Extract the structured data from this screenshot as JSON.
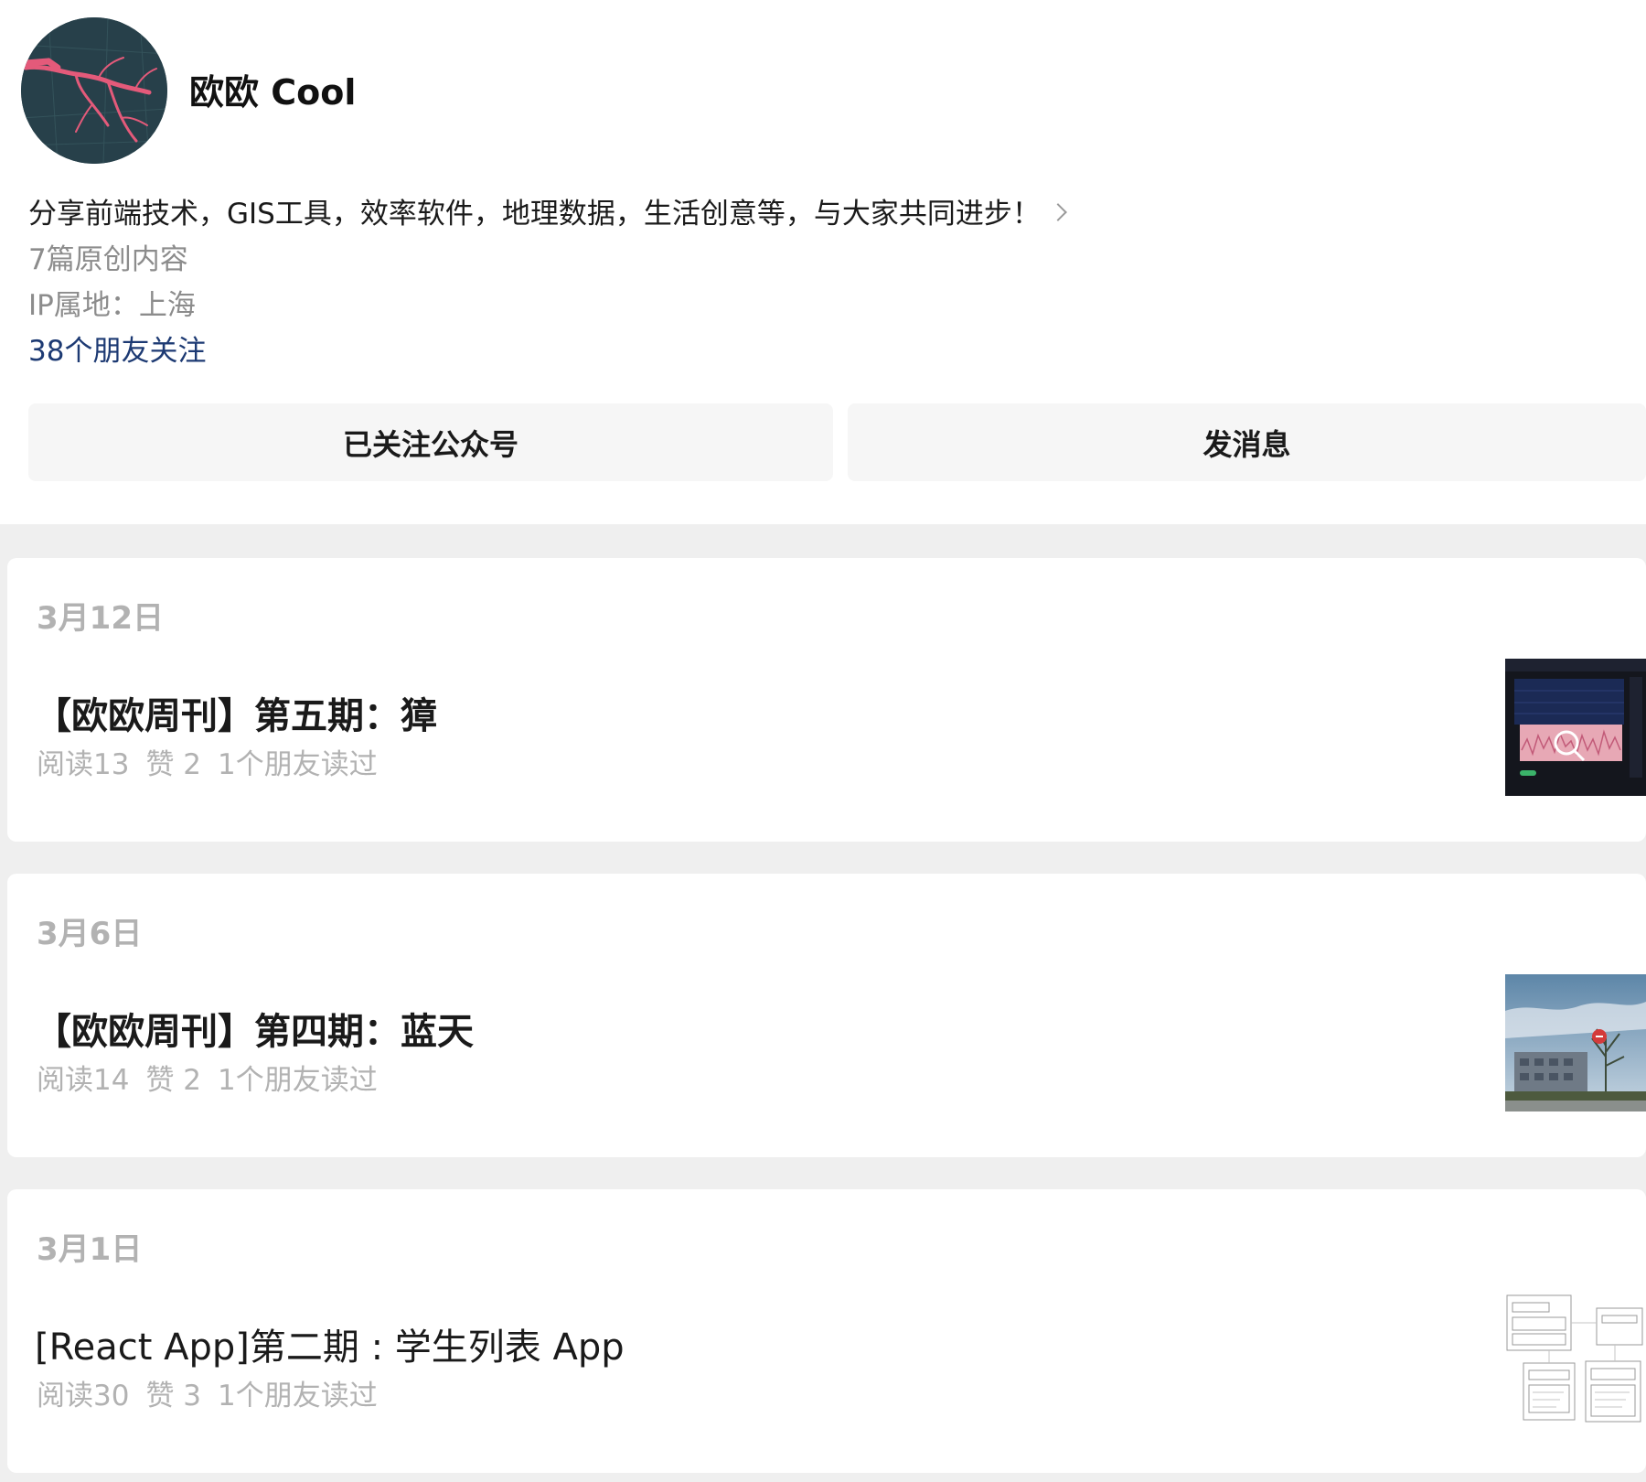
{
  "profile": {
    "name": "欧欧 Cool",
    "bio": "分享前端技术，GIS工具，效率软件，地理数据，生活创意等，与大家共同进步！",
    "original_count": "7篇原创内容",
    "ip_location": "IP属地：上海",
    "friends_following": "38个朋友关注",
    "follow_button": "已关注公众号",
    "message_button": "发消息",
    "avatar_icon": "river-map-avatar"
  },
  "articles": [
    {
      "date": "3月12日",
      "title": "【欧欧周刊】第五期：獐",
      "reads": "阅读13",
      "likes": "赞 2",
      "friends_read": "1个朋友读过",
      "thumbnail": "dark-dashboard-chart-thumbnail"
    },
    {
      "date": "3月6日",
      "title": "【欧欧周刊】第四期：蓝天",
      "reads": "阅读14",
      "likes": "赞 2",
      "friends_read": "1个朋友读过",
      "thumbnail": "blue-sky-building-thumbnail"
    },
    {
      "date": "3月1日",
      "title": "[React App]第二期 : 学生列表 App",
      "reads": "阅读30",
      "likes": "赞 3",
      "friends_read": "1个朋友读过",
      "thumbnail": "wireframe-diagram-thumbnail"
    }
  ],
  "colors": {
    "background": "#efefef",
    "card": "#ffffff",
    "link_blue": "#1d3a73",
    "muted_text": "#b2b2b2",
    "secondary_text": "#8c8c8c",
    "button_bg": "#f6f6f6"
  }
}
